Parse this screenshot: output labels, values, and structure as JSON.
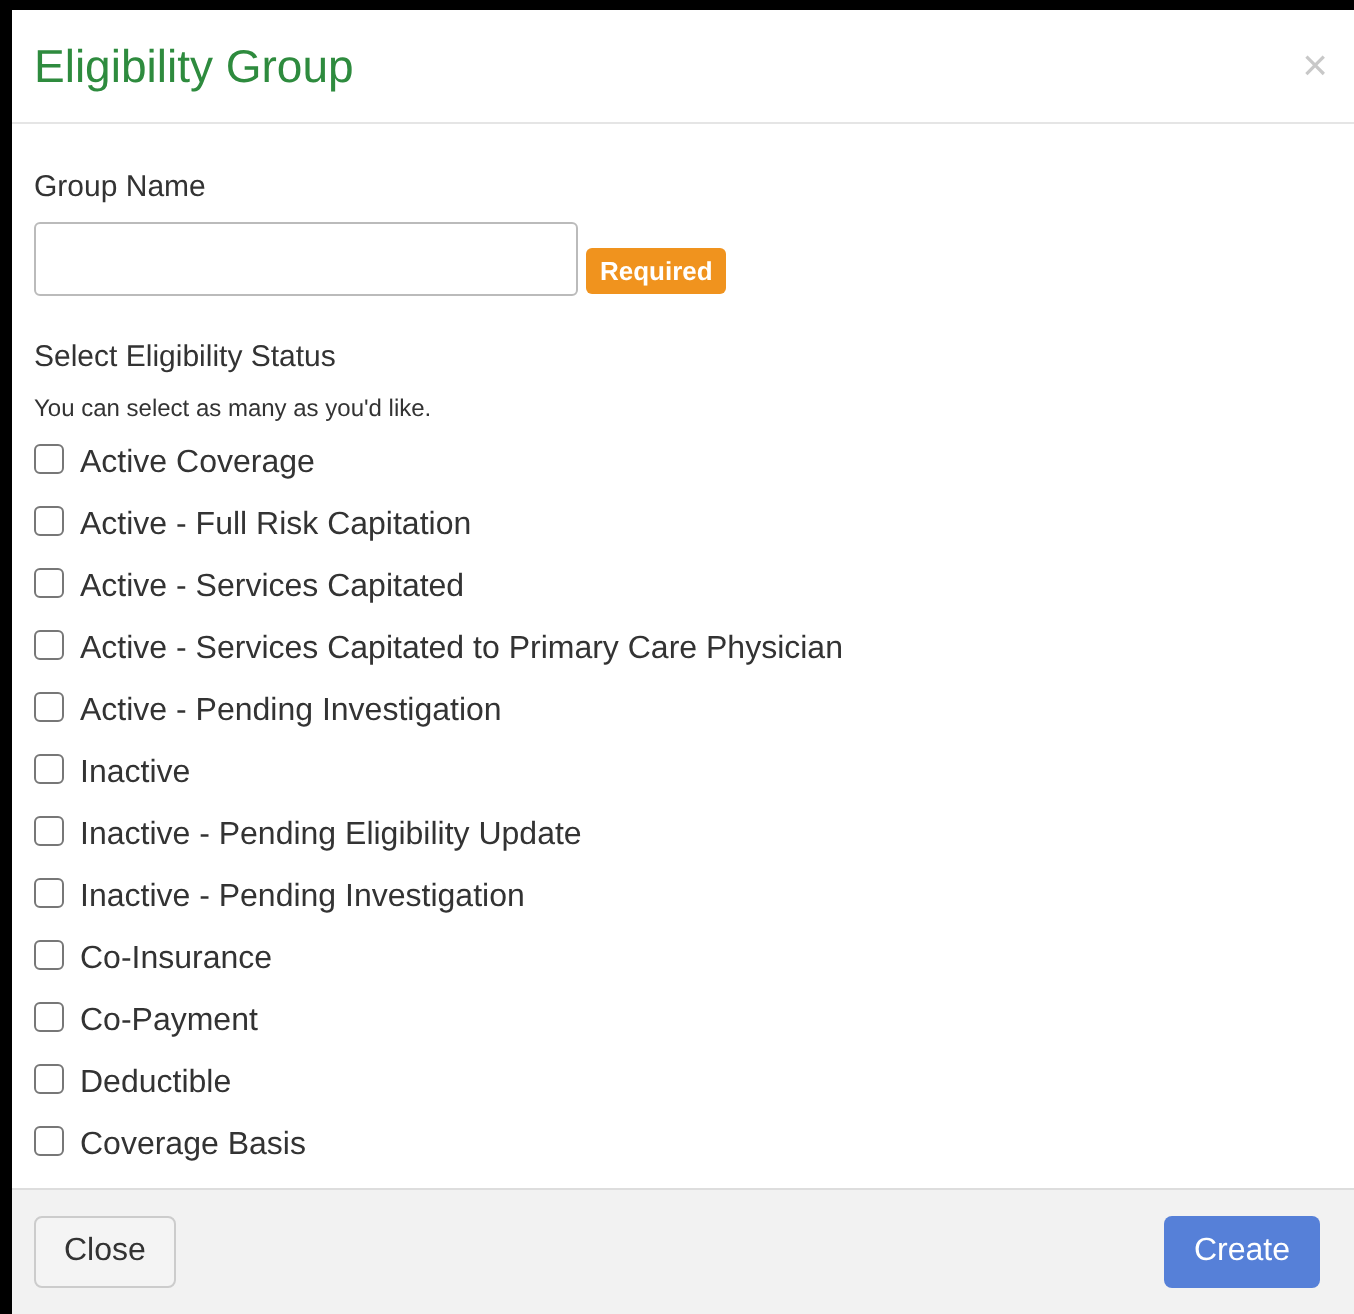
{
  "dialog": {
    "title": "Eligibility Group",
    "close_icon": "×"
  },
  "group_name": {
    "label": "Group Name",
    "badge": "Required"
  },
  "status": {
    "label": "Select Eligibility Status",
    "hint": "You can select as many as you'd like.",
    "options": [
      {
        "label": "Active Coverage",
        "checked": false
      },
      {
        "label": "Active - Full Risk Capitation",
        "checked": false
      },
      {
        "label": "Active - Services Capitated",
        "checked": false
      },
      {
        "label": "Active - Services Capitated to Primary Care Physician",
        "checked": false
      },
      {
        "label": "Active - Pending Investigation",
        "checked": false
      },
      {
        "label": "Inactive",
        "checked": false
      },
      {
        "label": "Inactive - Pending Eligibility Update",
        "checked": false
      },
      {
        "label": "Inactive - Pending Investigation",
        "checked": false
      },
      {
        "label": "Co-Insurance",
        "checked": false
      },
      {
        "label": "Co-Payment",
        "checked": false
      },
      {
        "label": "Deductible",
        "checked": false
      },
      {
        "label": "Coverage Basis",
        "checked": false
      }
    ]
  },
  "buttons": {
    "close": "Close",
    "create": "Create"
  }
}
